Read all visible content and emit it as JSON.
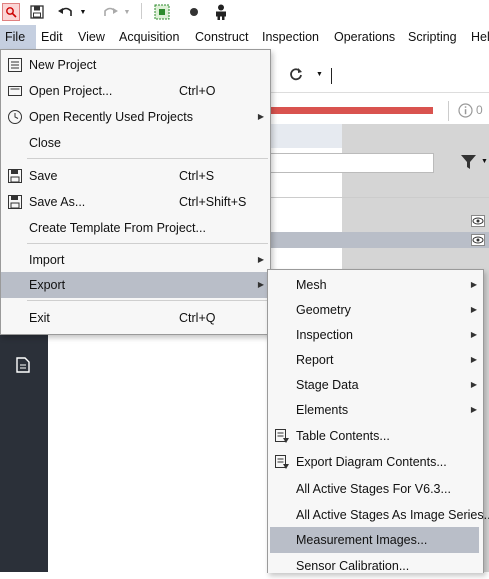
{
  "menubar": {
    "items": [
      "File",
      "Edit",
      "View",
      "Acquisition",
      "Construct",
      "Inspection",
      "Operations",
      "Scripting",
      "Hel"
    ]
  },
  "toolbar": {
    "indicator": "0"
  },
  "file_menu": {
    "new_project": "New Project",
    "open_project": "Open Project...",
    "open_project_sc": "Ctrl+O",
    "open_recent": "Open Recently Used Projects",
    "close": "Close",
    "save": "Save",
    "save_sc": "Ctrl+S",
    "save_as": "Save As...",
    "save_as_sc": "Ctrl+Shift+S",
    "create_template": "Create Template From Project...",
    "import": "Import",
    "export": "Export",
    "exit": "Exit",
    "exit_sc": "Ctrl+Q"
  },
  "export_menu": {
    "mesh": "Mesh",
    "geometry": "Geometry",
    "inspection": "Inspection",
    "report": "Report",
    "stage_data": "Stage Data",
    "elements": "Elements",
    "table_contents": "Table Contents...",
    "export_diagram": "Export Diagram Contents...",
    "active_v63": "All Active Stages For V6.3...",
    "active_series": "All Active Stages As Image Series...",
    "measurement_images": "Measurement Images...",
    "sensor_calibration": "Sensor Calibration..."
  },
  "colors": {
    "menu_highlight": "#b9bec8",
    "menubar_active": "#c5cfe0",
    "dark_panel": "#2b3039",
    "red_bar": "#d9534f"
  }
}
